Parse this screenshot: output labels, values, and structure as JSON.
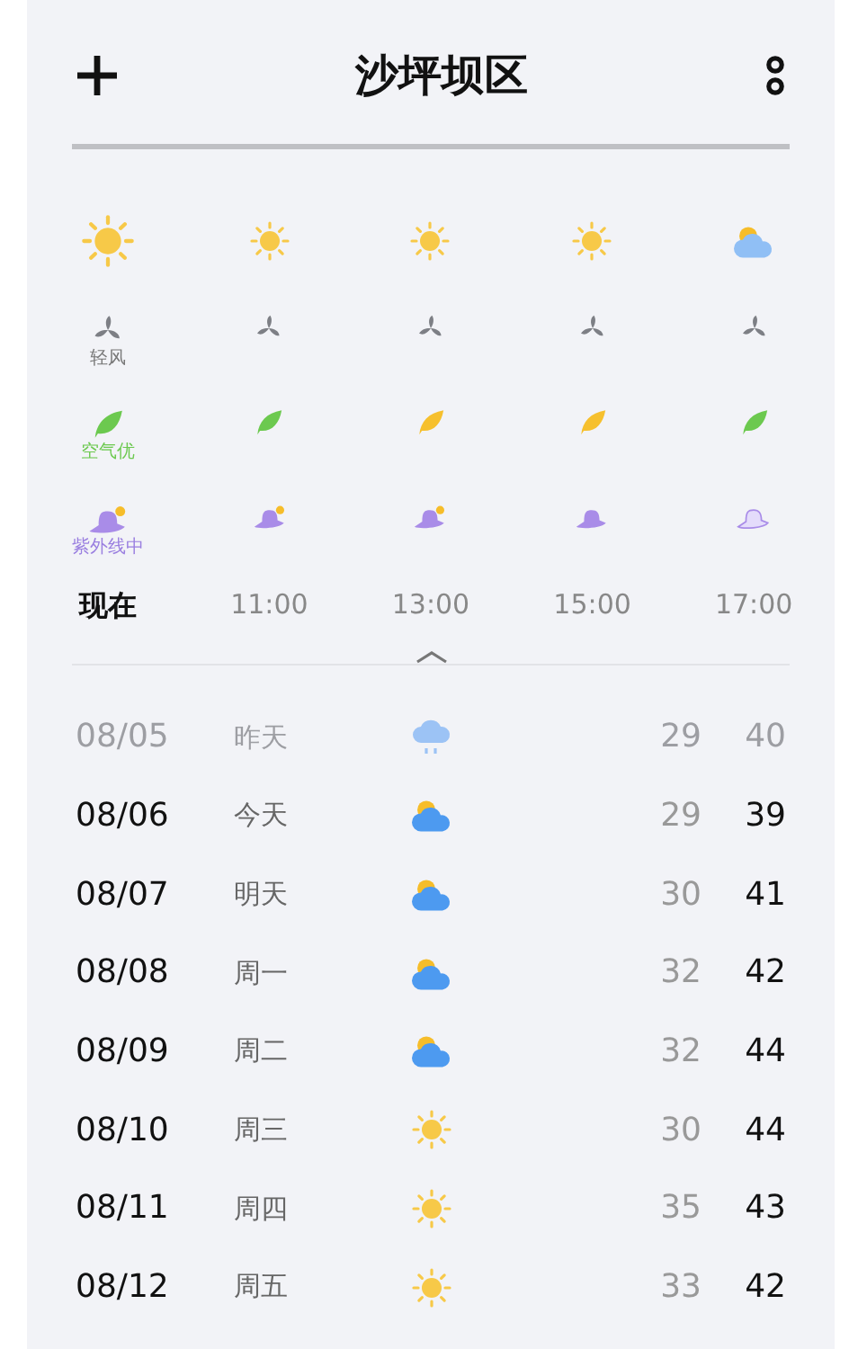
{
  "header": {
    "title": "沙坪坝区"
  },
  "hourly": [
    {
      "time": "现在",
      "current": true,
      "weather": {
        "kind": "sunny"
      },
      "wind": {
        "label": "轻风"
      },
      "air": {
        "color": "#6cc94f",
        "label": "空气优"
      },
      "uv": {
        "kind": "hat_sun",
        "label": "紫外线中"
      }
    },
    {
      "time": "11:00",
      "current": false,
      "weather": {
        "kind": "sunny"
      },
      "air": {
        "color": "#6cc94f"
      },
      "uv": {
        "kind": "hat_sun"
      }
    },
    {
      "time": "13:00",
      "current": false,
      "weather": {
        "kind": "sunny"
      },
      "air": {
        "color": "#f6c02e"
      },
      "uv": {
        "kind": "hat_sun"
      }
    },
    {
      "time": "15:00",
      "current": false,
      "weather": {
        "kind": "sunny"
      },
      "air": {
        "color": "#f6c02e"
      },
      "uv": {
        "kind": "hat"
      }
    },
    {
      "time": "17:00",
      "current": false,
      "weather": {
        "kind": "partly_cloudy"
      },
      "air": {
        "color": "#6cc94f"
      },
      "uv": {
        "kind": "hat_outline"
      }
    }
  ],
  "daily": [
    {
      "date": "08/05",
      "day": "昨天",
      "weather": {
        "kind": "rain"
      },
      "low": "29",
      "high": "40",
      "past": true
    },
    {
      "date": "08/06",
      "day": "今天",
      "weather": {
        "kind": "partly_cloudy"
      },
      "low": "29",
      "high": "39",
      "past": false
    },
    {
      "date": "08/07",
      "day": "明天",
      "weather": {
        "kind": "partly_cloudy"
      },
      "low": "30",
      "high": "41",
      "past": false
    },
    {
      "date": "08/08",
      "day": "周一",
      "weather": {
        "kind": "partly_cloudy"
      },
      "low": "32",
      "high": "42",
      "past": false
    },
    {
      "date": "08/09",
      "day": "周二",
      "weather": {
        "kind": "partly_cloudy"
      },
      "low": "32",
      "high": "44",
      "past": false
    },
    {
      "date": "08/10",
      "day": "周三",
      "weather": {
        "kind": "sunny"
      },
      "low": "30",
      "high": "44",
      "past": false
    },
    {
      "date": "08/11",
      "day": "周四",
      "weather": {
        "kind": "sunny"
      },
      "low": "35",
      "high": "43",
      "past": false
    },
    {
      "date": "08/12",
      "day": "周五",
      "weather": {
        "kind": "sunny"
      },
      "low": "33",
      "high": "42",
      "past": false
    }
  ]
}
